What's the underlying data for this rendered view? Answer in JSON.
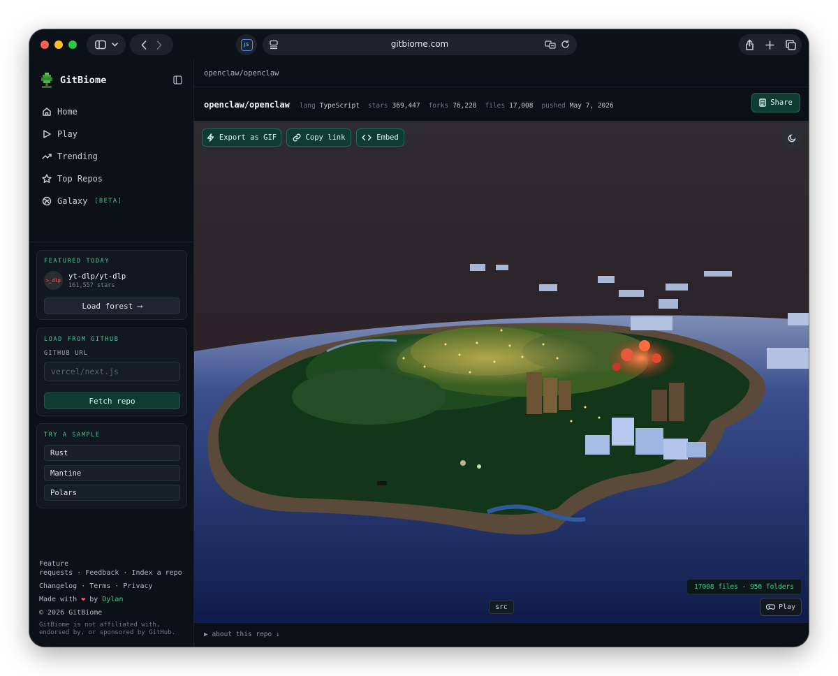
{
  "browser": {
    "url": "gitbiome.com",
    "traffic_lights": [
      "#ff5f57",
      "#febc2e",
      "#28c840"
    ],
    "extension_label": "JS"
  },
  "sidebar": {
    "brand": "GitBiome",
    "nav": [
      {
        "label": "Home",
        "icon": "home-icon"
      },
      {
        "label": "Play",
        "icon": "play-icon"
      },
      {
        "label": "Trending",
        "icon": "trending-icon"
      },
      {
        "label": "Top Repos",
        "icon": "star-icon"
      },
      {
        "label": "Galaxy",
        "icon": "galaxy-icon",
        "badge": "[BETA]"
      }
    ],
    "featured": {
      "title": "FEATURED TODAY",
      "avatar_text": ">_dlp",
      "repo": "yt-dlp/yt-dlp",
      "stars": "161,557 stars",
      "button": "Load forest ⟶"
    },
    "load": {
      "title": "LOAD FROM GITHUB",
      "field_label": "GITHUB URL",
      "placeholder": "vercel/next.js",
      "button": "Fetch repo"
    },
    "samples": {
      "title": "TRY A SAMPLE",
      "items": [
        "Rust",
        "Mantine",
        "Polars"
      ]
    },
    "footer": {
      "links1a": "Feature",
      "links1b": "requests · Feedback · Index a repo",
      "links2": "Changelog · Terms · Privacy",
      "made_prefix": "Made with",
      "made_by": "by",
      "author": "Dylan",
      "copyright": "© 2026 GitBiome",
      "disclaimer": "GitBiome is not affiliated with, endorsed by, or sponsored by GitHub."
    }
  },
  "main": {
    "breadcrumb": "openclaw/openclaw",
    "repo": "openclaw/openclaw",
    "meta": [
      {
        "key": "lang",
        "value": "TypeScript"
      },
      {
        "key": "stars",
        "value": "369,447"
      },
      {
        "key": "forks",
        "value": "76,228"
      },
      {
        "key": "files",
        "value": "17,008"
      },
      {
        "key": "pushed",
        "value": "May 7, 2026"
      }
    ],
    "share": "Share",
    "actions": {
      "gif": "Export as GIF",
      "copy": "Copy link",
      "embed": "Embed"
    },
    "stats": "17008 files · 956 folders",
    "play": "Play",
    "src": "src",
    "about": "▶ about this repo ↓"
  },
  "colors": {
    "accent": "#3fcf8e",
    "button_green": "#0f3b30",
    "background": "#0c1117"
  }
}
